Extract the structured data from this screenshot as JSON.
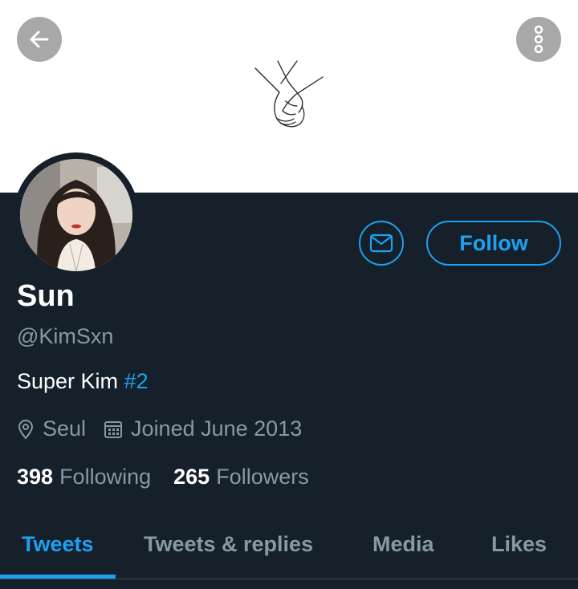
{
  "header": {
    "back_icon": "arrow-left-icon",
    "more_icon": "vertical-dots-icon",
    "banner_art": "holding-hands-illustration"
  },
  "profile": {
    "name": "Sun",
    "handle": "@KimSxn",
    "bio_text": "Super Kim ",
    "bio_hashtag": "#2",
    "location": "Seul",
    "joined": "Joined June 2013",
    "following_count": "398",
    "following_label": "Following",
    "followers_count": "265",
    "followers_label": "Followers"
  },
  "actions": {
    "message_icon": "envelope-icon",
    "follow_label": "Follow"
  },
  "tabs": [
    {
      "label": "Tweets",
      "active": true
    },
    {
      "label": "Tweets & replies",
      "active": false
    },
    {
      "label": "Media",
      "active": false
    },
    {
      "label": "Likes",
      "active": false
    }
  ],
  "colors": {
    "background": "#15202b",
    "accent": "#1da1f2",
    "secondary_text": "#8899a6",
    "banner": "#ffffff"
  }
}
